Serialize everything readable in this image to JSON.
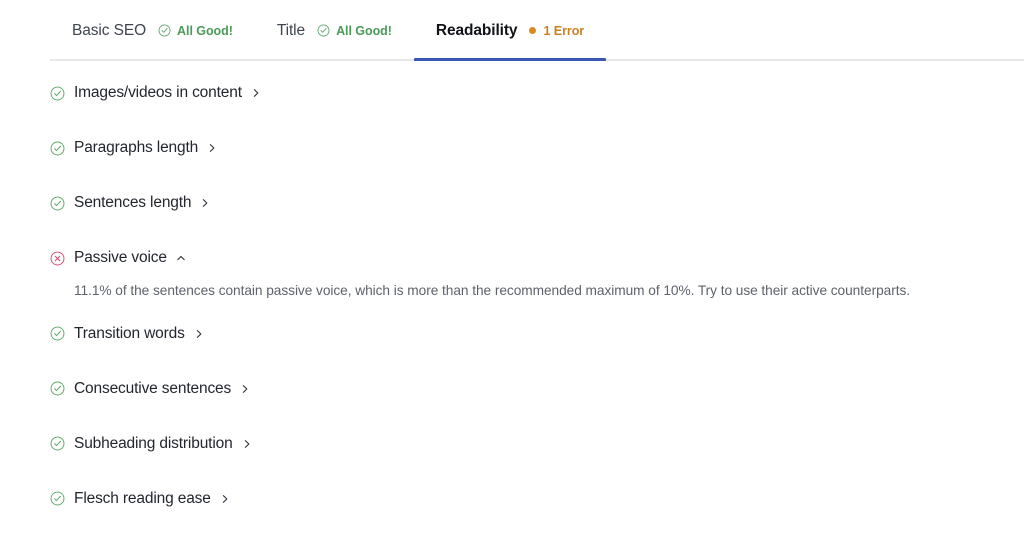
{
  "tabs": [
    {
      "label": "Basic SEO",
      "status_text": "All Good!",
      "status_type": "good",
      "active": false
    },
    {
      "label": "Title",
      "status_text": "All Good!",
      "status_type": "good",
      "active": false
    },
    {
      "label": "Readability",
      "status_text": "1 Error",
      "status_type": "error",
      "active": true
    }
  ],
  "checks": [
    {
      "label": "Images/videos in content",
      "state": "pass",
      "expanded": false,
      "chevron": "chevron-right-icon",
      "description": ""
    },
    {
      "label": "Paragraphs length",
      "state": "pass",
      "expanded": false,
      "chevron": "chevron-right-icon",
      "description": ""
    },
    {
      "label": "Sentences length",
      "state": "pass",
      "expanded": false,
      "chevron": "chevron-right-icon",
      "description": ""
    },
    {
      "label": "Passive voice",
      "state": "fail",
      "expanded": true,
      "chevron": "chevron-up-icon",
      "description": "11.1% of the sentences contain passive voice, which is more than the recommended maximum of 10%. Try to use their active counterparts."
    },
    {
      "label": "Transition words",
      "state": "pass",
      "expanded": false,
      "chevron": "chevron-right-icon",
      "description": ""
    },
    {
      "label": "Consecutive sentences",
      "state": "pass",
      "expanded": false,
      "chevron": "chevron-right-icon",
      "description": ""
    },
    {
      "label": "Subheading distribution",
      "state": "pass",
      "expanded": false,
      "chevron": "chevron-right-icon",
      "description": ""
    },
    {
      "label": "Flesch reading ease",
      "state": "pass",
      "expanded": false,
      "chevron": "chevron-right-icon",
      "description": ""
    }
  ],
  "colors": {
    "pass_green": "#5aa867",
    "fail_red": "#d24a6e",
    "error_orange": "#cc8021",
    "active_tab_underline": "#3a57b5",
    "text_primary": "#23262e",
    "text_secondary": "#5e626b",
    "rule_gray": "#e8e8ea"
  }
}
